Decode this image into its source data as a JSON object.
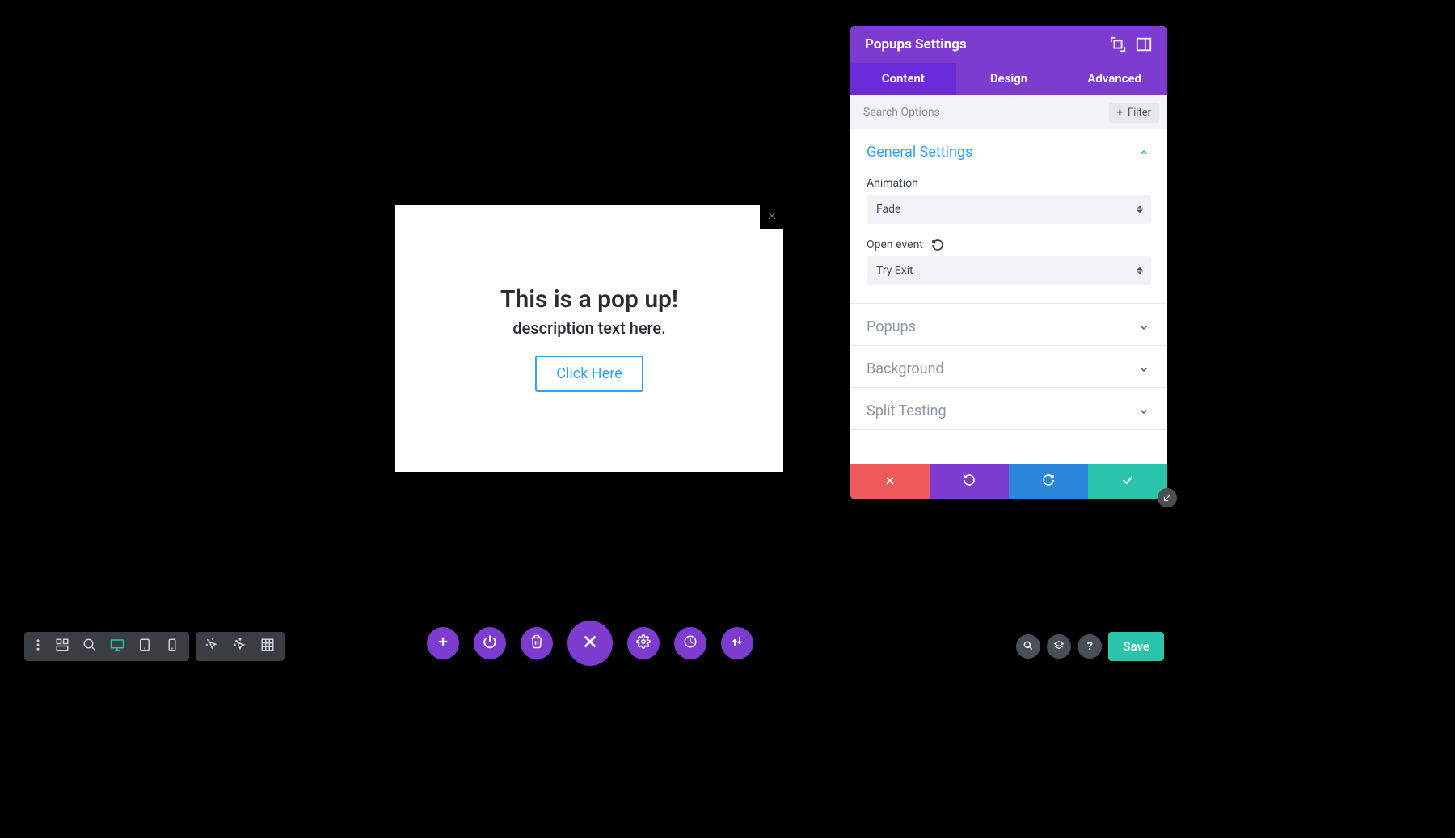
{
  "popup": {
    "title": "This is a pop up!",
    "description": "description text here.",
    "button_label": "Click Here"
  },
  "panel": {
    "title": "Popups Settings",
    "tabs": {
      "content": "Content",
      "design": "Design",
      "advanced": "Advanced",
      "active": "content"
    },
    "search_placeholder": "Search Options",
    "filter_label": "Filter",
    "sections": {
      "general": {
        "title": "General Settings",
        "expanded": true,
        "fields": {
          "animation": {
            "label": "Animation",
            "value": "Fade"
          },
          "open_event": {
            "label": "Open event",
            "value": "Try Exit"
          }
        }
      },
      "popups": {
        "title": "Popups",
        "expanded": false
      },
      "background": {
        "title": "Background",
        "expanded": false
      },
      "split_testing": {
        "title": "Split Testing",
        "expanded": false
      }
    }
  },
  "right_toolbar": {
    "save_label": "Save"
  }
}
